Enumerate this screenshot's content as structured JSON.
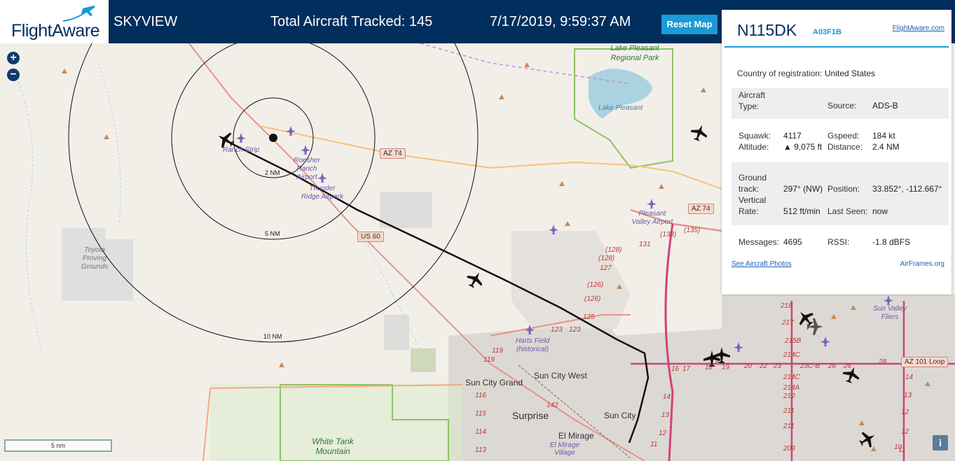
{
  "header": {
    "brand": "FlightAware",
    "title": "SKYVIEW",
    "tracked": "Total Aircraft Tracked: 145",
    "datetime": "7/17/2019, 9:59:37 AM",
    "reset_label": "Reset Map"
  },
  "map": {
    "zoom_in": "+",
    "zoom_out": "−",
    "scale_label": "5 nm",
    "info_label": "i",
    "rings": [
      "2 NM",
      "5 NM",
      "10 NM"
    ],
    "airports": [
      "Ranch Strip",
      "Roesher Ranch Airport",
      "Thunder Ridge Airpark",
      "Pleasant Valley Airport",
      "Harts Field (historical)",
      "Sun Valley Fliers"
    ],
    "places": [
      "Lake Pleasant Regional Park",
      "Lake Pleasant",
      "Toyota Proving Grounds",
      "Sun City Grand",
      "Sun City West",
      "Surprise",
      "El Mirage",
      "Sun City",
      "White Tank Mountain",
      "El Mirage Village"
    ],
    "shields": [
      "AZ 74",
      "AZ 74",
      "US 60",
      "AZ 101 Loop"
    ],
    "exits": [
      "(128)",
      "(128)",
      "127",
      "(126)",
      "(126)",
      "125",
      "123",
      "123",
      "119",
      "119",
      "116",
      "115",
      "114",
      "113",
      "142",
      "131",
      "(138)",
      "(135)",
      "218",
      "217",
      "215B",
      "214C",
      "214C",
      "214A",
      "212",
      "211",
      "211",
      "209",
      "17",
      "16",
      "18",
      "19",
      "20",
      "22",
      "23",
      "23C-B",
      "26",
      "26",
      "28",
      "14",
      "13",
      "12",
      "12",
      "11",
      "10",
      "14",
      "13",
      "12",
      "11"
    ]
  },
  "panel": {
    "registration": "N115DK",
    "hex": "A03F1B",
    "fa_link": "FlightAware.com",
    "country_label": "Country of registration:",
    "country_value": "United States",
    "aircraft_type_label": "Aircraft Type:",
    "aircraft_type_value": "",
    "source_label": "Source:",
    "source_value": "ADS-B",
    "squawk_label": "Squawk:",
    "squawk_value": "4117",
    "gspeed_label": "Gspeed:",
    "gspeed_value": "184 kt",
    "altitude_label": "Altitude:",
    "altitude_value": "▲ 9,075 ft",
    "distance_label": "Distance:",
    "distance_value": "2.4 NM",
    "ground_track_label": "Ground track:",
    "ground_track_value": "297° (NW)",
    "position_label": "Position:",
    "position_value": "33.852°, -112.667°",
    "vrate_label": "Vertical Rate:",
    "vrate_value": "512 ft/min",
    "last_seen_label": "Last Seen:",
    "last_seen_value": "now",
    "messages_label": "Messages:",
    "messages_value": "4695",
    "rssi_label": "RSSI:",
    "rssi_value": "-1.8 dBFS",
    "photos_link": "See Aircraft Photos",
    "airframes_link": "AirFrames.org"
  },
  "colors": {
    "header_bg": "#002f5d",
    "accent": "#1a9ad6",
    "lake": "#aad3df",
    "road": "#e8928b",
    "urban": "#dcd9d5"
  }
}
